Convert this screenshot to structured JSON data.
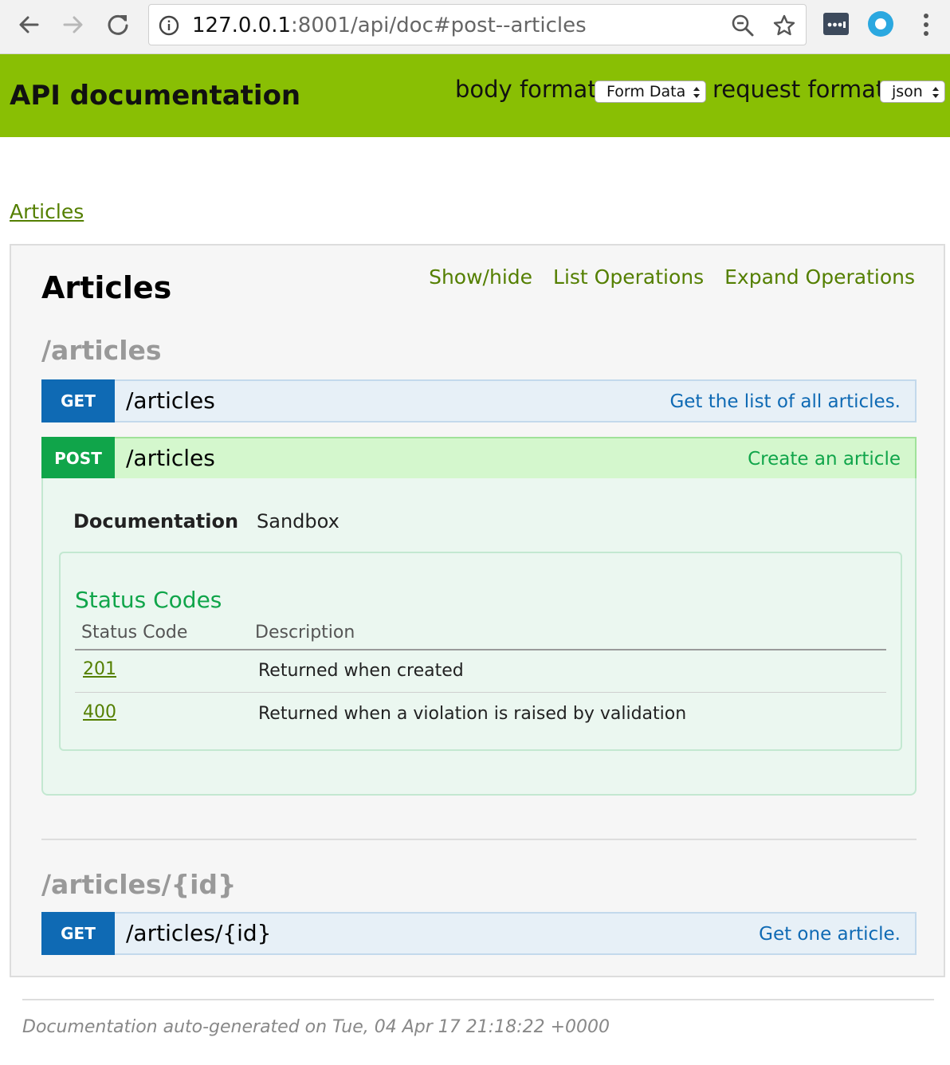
{
  "browser": {
    "url_host": "127.0.0.1",
    "url_rest": ":8001/api/doc#post--articles",
    "icons": [
      "back-icon",
      "forward-icon",
      "reload-icon",
      "info-icon",
      "zoom-icon",
      "bookmark-star-icon",
      "extension-icon",
      "extension-circle-icon",
      "menu-dots-icon"
    ]
  },
  "header": {
    "title": "API documentation",
    "body_format_label": "body format:",
    "body_format_value": "Form Data",
    "request_format_label": "request format:",
    "request_format_value": "json"
  },
  "breadcrumb": {
    "link": "Articles"
  },
  "resource": {
    "title": "Articles",
    "ops": [
      "Show/hide",
      "List Operations",
      "Expand Operations"
    ],
    "sections": [
      {
        "heading": "/articles",
        "operations": [
          {
            "method": "GET",
            "path": "/articles",
            "summary": "Get the list of all articles."
          },
          {
            "method": "POST",
            "path": "/articles",
            "summary": "Create an article"
          }
        ]
      },
      {
        "heading": "/articles/{id}",
        "operations": [
          {
            "method": "GET",
            "path": "/articles/{id}",
            "summary": "Get one article."
          }
        ]
      }
    ],
    "expanded": {
      "tab_documentation": "Documentation",
      "tab_sandbox": "Sandbox",
      "status_title": "Status Codes",
      "col_code": "Status Code",
      "col_desc": "Description",
      "rows": [
        {
          "code": "201",
          "description": "Returned when created"
        },
        {
          "code": "400",
          "description": "Returned when a violation is raised by validation"
        }
      ]
    }
  },
  "footer": {
    "text": "Documentation auto-generated on Tue, 04 Apr 17 21:18:22 +0000"
  },
  "colors": {
    "header_green": "#89bf04",
    "link_green": "#547f00",
    "get_blue": "#0f6ab4",
    "post_green": "#10a54a"
  }
}
